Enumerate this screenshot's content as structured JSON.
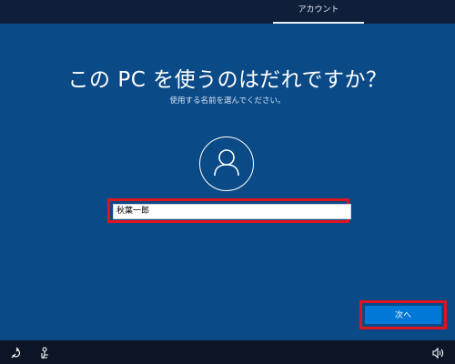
{
  "header": {
    "tab_account": "アカウント"
  },
  "main": {
    "title": "この PC を使うのはだれですか？",
    "subtitle": "使用する名前を選んでください。",
    "name_value": "秋葉一郎"
  },
  "actions": {
    "next_label": "次へ"
  },
  "bottom": {
    "icons": [
      "ease-of-access-icon",
      "accessibility-narrator-icon",
      "volume-icon"
    ]
  },
  "colors": {
    "background": "#0a4a86",
    "topbar": "#0f1f3a",
    "bottombar": "#0b1526",
    "highlight": "#e0141e",
    "button": "#0078d7"
  }
}
